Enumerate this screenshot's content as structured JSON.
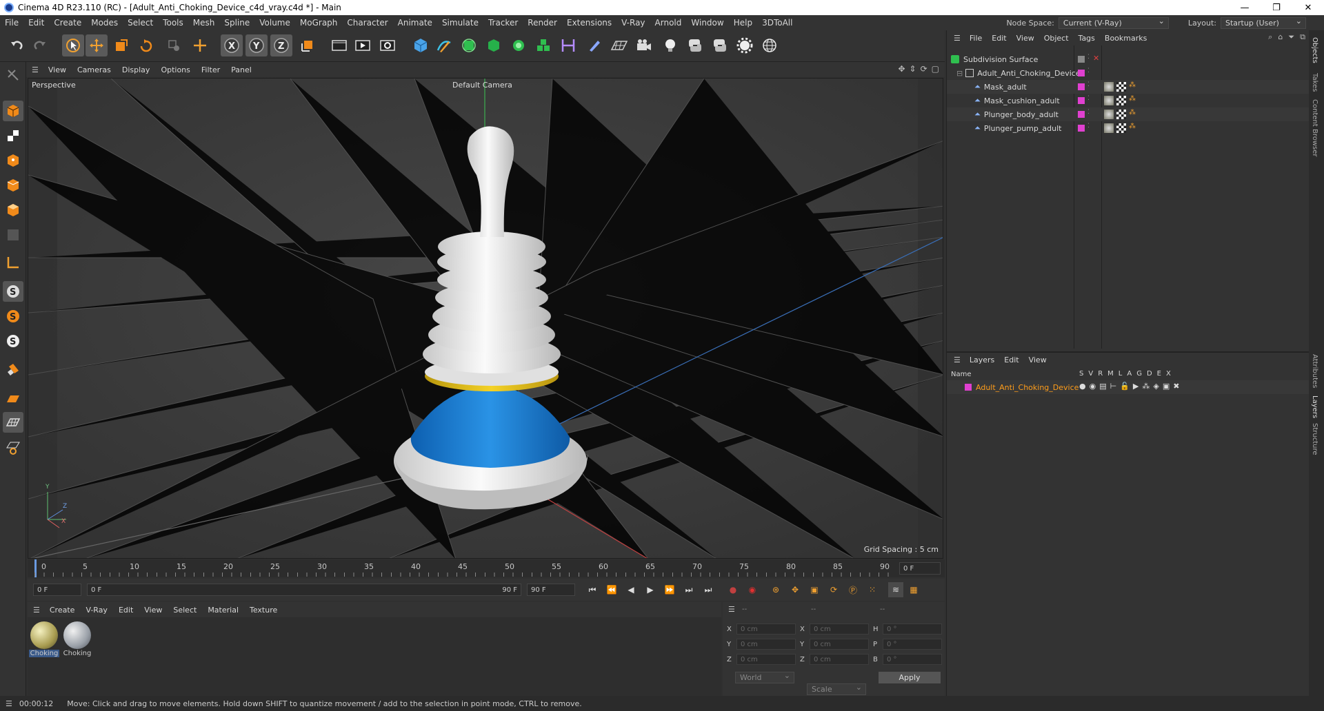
{
  "window": {
    "title": "Cinema 4D R23.110 (RC) - [Adult_Anti_Choking_Device_c4d_vray.c4d *] - Main",
    "minimize": "—",
    "maximize": "❐",
    "close": "✕"
  },
  "menubar": {
    "items": [
      "File",
      "Edit",
      "Create",
      "Modes",
      "Select",
      "Tools",
      "Mesh",
      "Spline",
      "Volume",
      "MoGraph",
      "Character",
      "Animate",
      "Simulate",
      "Tracker",
      "Render",
      "Extensions",
      "V-Ray",
      "Arnold",
      "Window",
      "Help",
      "3DToAll"
    ],
    "node_space_label": "Node Space:",
    "node_space_value": "Current (V-Ray)",
    "layout_label": "Layout:",
    "layout_value": "Startup (User)"
  },
  "viewport": {
    "menu": [
      "View",
      "Cameras",
      "Display",
      "Options",
      "Filter",
      "Panel"
    ],
    "label": "Perspective",
    "camera": "Default Camera",
    "grid_spacing": "Grid Spacing : 5 cm",
    "axis_y": "Y",
    "axis_z": "Z",
    "axis_x": "X"
  },
  "timeline": {
    "ticks": [
      "0",
      "5",
      "10",
      "15",
      "20",
      "25",
      "30",
      "35",
      "40",
      "45",
      "50",
      "55",
      "60",
      "65",
      "70",
      "75",
      "80",
      "85",
      "90"
    ],
    "frame_end_field": "0 F"
  },
  "playbar": {
    "start": "0 F",
    "range_start": "0 F",
    "range_end": "90 F",
    "end": "90 F"
  },
  "material_menu": [
    "Create",
    "V-Ray",
    "Edit",
    "View",
    "Select",
    "Material",
    "Texture"
  ],
  "materials": [
    {
      "name": "Choking"
    },
    {
      "name": "Choking"
    }
  ],
  "coords": {
    "header1": "--",
    "header2": "--",
    "header3": "--",
    "rows": [
      {
        "a": "X",
        "av": "0 cm",
        "b": "X",
        "bv": "0 cm",
        "c": "H",
        "cv": "0 °"
      },
      {
        "a": "Y",
        "av": "0 cm",
        "b": "Y",
        "bv": "0 cm",
        "c": "P",
        "cv": "0 °"
      },
      {
        "a": "Z",
        "av": "0 cm",
        "b": "Z",
        "bv": "0 cm",
        "c": "B",
        "cv": "0 °"
      }
    ],
    "world": "World",
    "scale": "Scale",
    "apply": "Apply"
  },
  "objects": {
    "menu": [
      "File",
      "Edit",
      "View",
      "Object",
      "Tags",
      "Bookmarks"
    ],
    "items": [
      {
        "name": "Subdivision Surface"
      },
      {
        "name": "Adult_Anti_Choking_Device"
      },
      {
        "name": "Mask_adult"
      },
      {
        "name": "Mask_cushion_adult"
      },
      {
        "name": "Plunger_body_adult"
      },
      {
        "name": "Plunger_pump_adult"
      }
    ]
  },
  "layers": {
    "menu": [
      "Layers",
      "Edit",
      "View"
    ],
    "name_header": "Name",
    "cols": [
      "S",
      "V",
      "R",
      "M",
      "L",
      "A",
      "G",
      "D",
      "E",
      "X"
    ],
    "item": "Adult_Anti_Choking_Device"
  },
  "sidetabs": [
    "Objects",
    "Takes",
    "Content Browser",
    "Attributes",
    "Layers",
    "Structure"
  ],
  "status": {
    "time": "00:00:12",
    "message": "Move: Click and drag to move elements. Hold down SHIFT to quantize movement / add to the selection in point mode, CTRL to remove."
  },
  "colors": {
    "accent": "#e040d0",
    "layer_text": "#ff9d1a",
    "mask_blue": "#1b7fd6",
    "ring_yellow": "#e6c21a"
  }
}
